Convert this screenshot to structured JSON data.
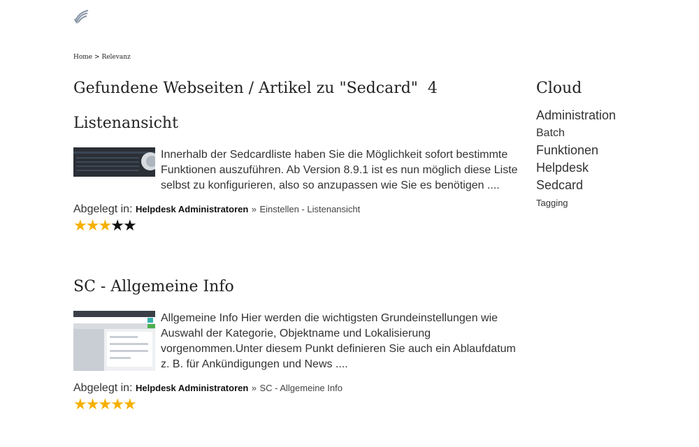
{
  "breadcrumb": {
    "home": "Home",
    "separator": ">",
    "current": "Relevanz"
  },
  "page_title": {
    "text": "Gefundene Webseiten / Artikel zu \"Sedcard\"",
    "count": "4"
  },
  "results": [
    {
      "title": "Listenansicht",
      "snippet": "Innerhalb der Sedcardliste haben Sie die Möglichkeit sofort bestimmte Funktionen auszuführen. Ab Version 8.9.1 ist es nun möglich diese Liste selbst zu konfigurieren, also so anzupassen wie Sie es benötigen ....",
      "filed_label": "Abgelegt in:",
      "category": "Helpdesk Administratoren",
      "separator": "»",
      "topic": "Einstellen - Listenansicht",
      "rating": 3,
      "rating_max": 5
    },
    {
      "title": "SC - Allgemeine Info",
      "snippet": "Allgemeine Info Hier werden die wichtigsten Grundeinstellungen wie Auswahl der Kategorie, Objektname und Lokalisierung vorgenommen.Unter diesem Punkt definieren Sie auch ein Ablaufdatum z. B. für Ankündigungen und News ....",
      "filed_label": "Abgelegt in:",
      "category": "Helpdesk Administratoren",
      "separator": "»",
      "topic": "SC - Allgemeine Info",
      "rating": 5,
      "rating_max": 5
    }
  ],
  "cloud": {
    "title": "Cloud",
    "tags": [
      {
        "label": "Administration",
        "weight": "large"
      },
      {
        "label": "Batch",
        "weight": "medium"
      },
      {
        "label": "Funktionen",
        "weight": "large"
      },
      {
        "label": "Helpdesk",
        "weight": "large"
      },
      {
        "label": "Sedcard",
        "weight": "large"
      },
      {
        "label": "Tagging",
        "weight": "small"
      }
    ]
  },
  "colors": {
    "star_filled": "#f5b000",
    "star_empty": "#111111",
    "text": "#222222"
  },
  "icons": {
    "logo": "wing-logo-icon",
    "star": "star-icon"
  }
}
